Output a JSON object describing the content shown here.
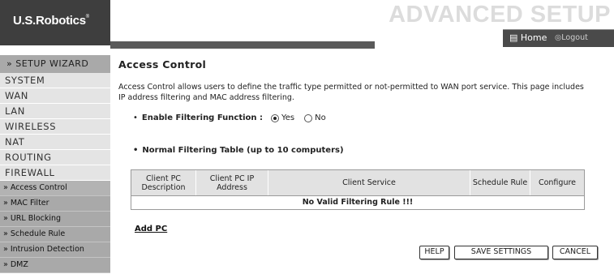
{
  "header": {
    "logo": "U.S.Robotics",
    "logo_mark": "®",
    "banner_title": "ADVANCED SETUP",
    "home_label": "Home",
    "logout_label": "Logout"
  },
  "sidebar": {
    "wizard": "» SETUP WIZARD",
    "main_items": [
      "SYSTEM",
      "WAN",
      "LAN",
      "WIRELESS",
      "NAT",
      "ROUTING",
      "FIREWALL"
    ],
    "sub_items": [
      "» Access Control",
      "» MAC Filter",
      "» URL Blocking",
      "» Schedule Rule",
      "» Intrusion Detection",
      "» DMZ"
    ]
  },
  "main": {
    "title": "Access Control",
    "intro": "Access Control allows users to define the traffic type permitted or not-permitted to WAN port service. This page includes IP address filtering and MAC address filtering.",
    "filter": {
      "label": "Enable Filtering Function :",
      "options": [
        "Yes",
        "No"
      ],
      "selected": "Yes"
    },
    "table_label": "Normal Filtering Table (up to 10 computers)",
    "table": {
      "headers": [
        "Client PC Description",
        "Client PC IP Address",
        "Client Service",
        "Schedule Rule",
        "Configure"
      ],
      "empty_message": "No Valid Filtering Rule !!!"
    },
    "add_pc": "Add PC"
  },
  "buttons": {
    "help": "HELP",
    "save": "SAVE SETTINGS",
    "cancel": "CANCEL"
  }
}
